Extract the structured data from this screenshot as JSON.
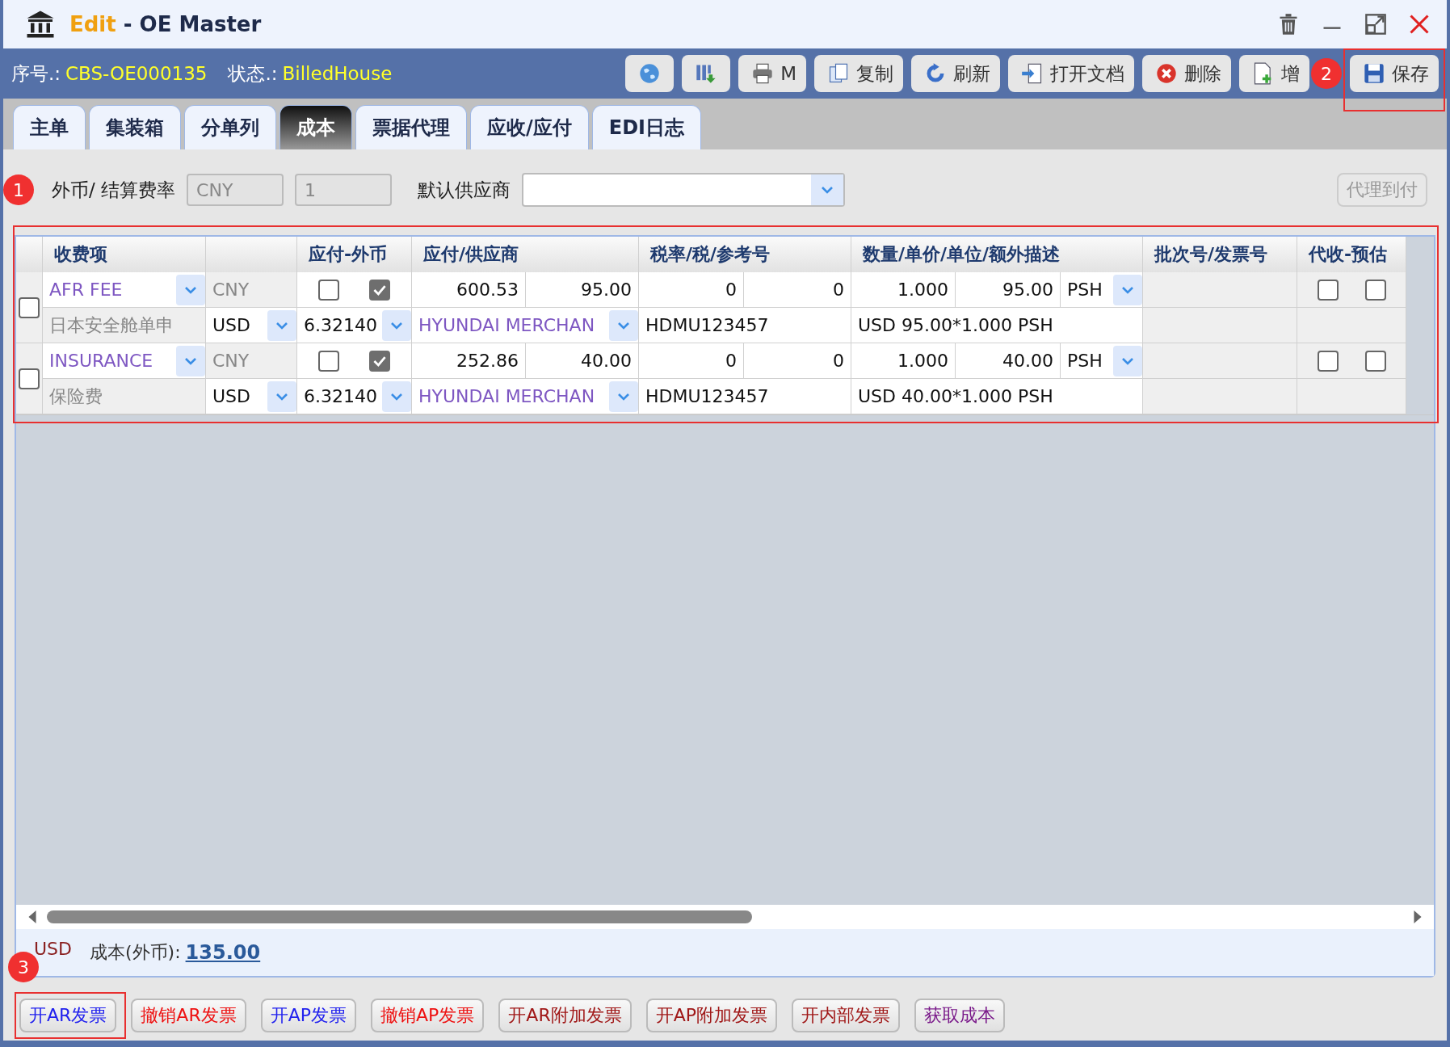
{
  "window": {
    "mode": "Edit",
    "separator": "-",
    "title": "OE Master"
  },
  "info": [
    {
      "label": "序号.:",
      "value": "CBS-OE000135"
    },
    {
      "label": "状态.:",
      "value": "BilledHouse"
    }
  ],
  "toolbar": [
    {
      "kind": "globe"
    },
    {
      "kind": "columns"
    },
    {
      "kind": "print",
      "label": "M"
    },
    {
      "kind": "copy",
      "label": "复制"
    },
    {
      "kind": "refresh",
      "label": "刷新"
    },
    {
      "kind": "open",
      "label": "打开文档"
    },
    {
      "kind": "delete",
      "label": "删除"
    },
    {
      "kind": "add",
      "label": "增"
    },
    {
      "kind": "save",
      "label": "保存"
    }
  ],
  "tabs": [
    {
      "label": "主单",
      "selected": false
    },
    {
      "label": "集装箱",
      "selected": false
    },
    {
      "label": "分单列",
      "selected": false
    },
    {
      "label": "成本",
      "selected": true
    },
    {
      "label": "票据代理",
      "selected": false
    },
    {
      "label": "应收/应付",
      "selected": false
    },
    {
      "label": "EDI日志",
      "selected": false
    }
  ],
  "rate_row": {
    "label": "外币/ 结算费率",
    "currency": "CNY",
    "rate": "1",
    "supplier_label": "默认供应商",
    "agent_button": "代理到付"
  },
  "table": {
    "columns": [
      "收费项",
      "应付-外币",
      "应付/供应商",
      "税率/税/参考号",
      "数量/单价/单位/额外描述",
      "批次号/发票号",
      "代收-预估"
    ],
    "rows": [
      {
        "selected": false,
        "charge": "AFR FEE",
        "currency": "CNY",
        "foreign": false,
        "payable": true,
        "amount": "600.53",
        "price_fx": "95.00",
        "tax_rate": "0",
        "tax": "0",
        "qty": "1.000",
        "unit_price": "95.00",
        "unit": "PSH",
        "collect": false,
        "estimate": false,
        "description": "日本安全舱单申",
        "fx_currency": "USD",
        "rate": "6.32140",
        "supplier": "HYUNDAI MERCHAN",
        "reference": "HDMU123457",
        "extra": "USD 95.00*1.000 PSH"
      },
      {
        "selected": false,
        "charge": "INSURANCE",
        "currency": "CNY",
        "foreign": false,
        "payable": true,
        "amount": "252.86",
        "price_fx": "40.00",
        "tax_rate": "0",
        "tax": "0",
        "qty": "1.000",
        "unit_price": "40.00",
        "unit": "PSH",
        "collect": false,
        "estimate": false,
        "description": "保险费",
        "fx_currency": "USD",
        "rate": "6.32140",
        "supplier": "HYUNDAI MERCHAN",
        "reference": "HDMU123457",
        "extra": "USD 40.00*1.000 PSH"
      }
    ]
  },
  "summary": {
    "currency": "USD",
    "label": "成本(外币):",
    "value": "135.00"
  },
  "actions": [
    {
      "label": "开AR发票",
      "color": "#2222ee"
    },
    {
      "label": "撤销AR发票",
      "color": "#ee1111"
    },
    {
      "label": "开AP发票",
      "color": "#2222ee"
    },
    {
      "label": "撤销AP发票",
      "color": "#ee1111"
    },
    {
      "label": "开AR附加发票",
      "color": "#a01818"
    },
    {
      "label": "开AP附加发票",
      "color": "#a01818"
    },
    {
      "label": "开内部发票",
      "color": "#a01818"
    },
    {
      "label": "获取成本",
      "color": "#7a1a8a"
    }
  ],
  "callouts": [
    "1",
    "2",
    "3"
  ]
}
